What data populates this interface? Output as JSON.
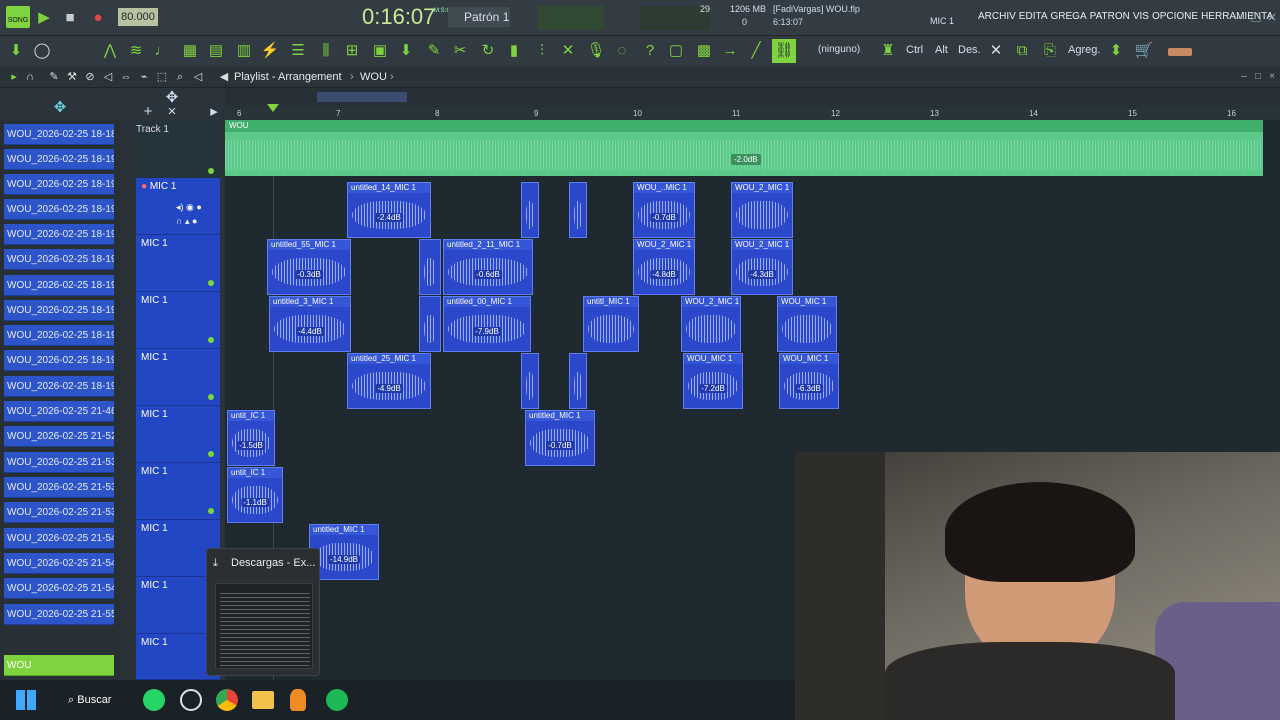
{
  "topbar": {
    "song_badge": "SONG",
    "tempo": "80.000",
    "time_display": "0:16:07",
    "time_unit": "M:S:CS",
    "pattern": "Patrón 1",
    "cpu": "29",
    "memory": "1206 MB",
    "memory_sub": "0",
    "project": "[FadiVargas] WOU.flp",
    "project_time": "6:13:07",
    "channel_hint": "MIC 1",
    "menu": [
      "ARCHIV",
      "EDITA",
      "GREGA",
      "PATRON",
      "VIS",
      "OPCIONE",
      "HERRAMIENTA"
    ]
  },
  "toolbar": {
    "pattern_none": "(ninguno)",
    "ctrl": "Ctrl",
    "alt": "Alt",
    "des": "Des.",
    "agreg": "Agreg."
  },
  "playlist": {
    "title": "Playlist - Arrangement",
    "crumb_sep": "›",
    "project": "WOU"
  },
  "ruler": {
    "marks": [
      "6",
      "7",
      "8",
      "9",
      "10",
      "11",
      "12",
      "13",
      "14",
      "15",
      "16"
    ]
  },
  "browser_items": [
    "WOU_2026-02-25 18-18-...",
    "WOU_2026-02-25 18-19-...",
    "WOU_2026-02-25 18-19-...",
    "WOU_2026-02-25 18-19-...",
    "WOU_2026-02-25 18-19-...",
    "WOU_2026-02-25 18-19-...",
    "WOU_2026-02-25 18-19-...",
    "WOU_2026-02-25 18-19-...",
    "WOU_2026-02-25 18-19-...",
    "WOU_2026-02-25 18-19-...",
    "WOU_2026-02-25 18-19-...",
    "WOU_2026-02-25 21-46-...",
    "WOU_2026-02-25 21-52-...",
    "WOU_2026-02-25 21-53-...",
    "WOU_2026-02-25 21-53-...",
    "WOU_2026-02-25 21-53-...",
    "WOU_2026-02-25 21-54-...",
    "WOU_2026-02-25 21-54-...",
    "WOU_2026-02-25 21-54-...",
    "WOU_2026-02-25 21-55-...",
    "WOU"
  ],
  "tracks": {
    "first": "Track 1",
    "master_clip": "WOU",
    "master_gain": "-2.0dB",
    "mic": "MIC 1"
  },
  "clips": [
    {
      "name": "untitled_14_MIC 1",
      "gain": "-2.4dB"
    },
    {
      "name": "WOU_..MIC 1",
      "gain": "-0.7dB"
    },
    {
      "name": "WOU_2_MIC 1",
      "gain": ""
    },
    {
      "name": "untitled_55_MIC 1",
      "gain": "-0.3dB"
    },
    {
      "name": "untitled_2_11_MIC 1",
      "gain": "-0.6dB"
    },
    {
      "name": "WOU_2_MIC 1",
      "gain": "-4.8dB"
    },
    {
      "name": "WOU_2_MIC 1",
      "gain": "-4.3dB"
    },
    {
      "name": "untitled_3_MIC 1",
      "gain": "-4.4dB"
    },
    {
      "name": "untitled_00_MIC 1",
      "gain": "-7.9dB"
    },
    {
      "name": "untitl_MIC 1",
      "gain": ""
    },
    {
      "name": "WOU_2_MIC 1",
      "gain": ""
    },
    {
      "name": "WOU_MIC 1",
      "gain": ""
    },
    {
      "name": "untitled_25_MIC 1",
      "gain": "-4.9dB"
    },
    {
      "name": "WOU_MIC 1",
      "gain": "-7.2dB"
    },
    {
      "name": "WOU_MIC 1",
      "gain": "-6.3dB"
    },
    {
      "name": "untit_IC 1",
      "gain": "-1.5dB"
    },
    {
      "name": "untitled_MIC 1",
      "gain": "-0.7dB"
    },
    {
      "name": "untit_IC 1",
      "gain": "-1.1dB"
    },
    {
      "name": "untitled_MIC 1",
      "gain": "-14.9dB"
    }
  ],
  "download_popup": {
    "label": "Descargas - Ex..."
  },
  "taskbar": {
    "search": "Buscar"
  }
}
